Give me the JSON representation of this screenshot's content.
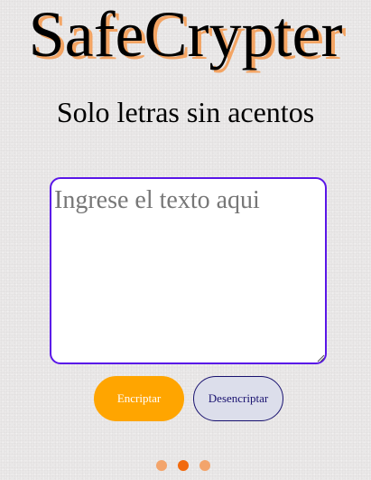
{
  "header": {
    "title": "SafeCrypter",
    "subtitle": "Solo letras sin acentos"
  },
  "input": {
    "value": "",
    "placeholder": "Ingrese el texto aqui"
  },
  "buttons": {
    "encrypt_label": "Encriptar",
    "decrypt_label": "Desencriptar"
  },
  "indicator": {
    "count": 3,
    "active_index": 1
  },
  "colors": {
    "title_shadow": "#f3a463",
    "accent_orange": "#ffa500",
    "textarea_border": "#5a16e8",
    "decrypt_bg": "#dcdeeb",
    "decrypt_text": "#1a1370",
    "dot_inactive": "#f3a46b",
    "dot_active": "#f26a0e"
  }
}
